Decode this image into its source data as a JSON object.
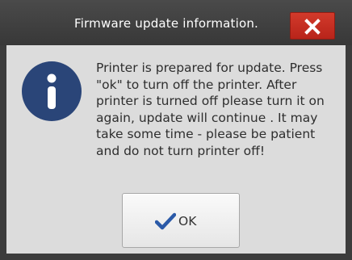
{
  "dialog": {
    "title": "Firmware update information.",
    "close_icon": "close-icon",
    "close_color": "#c9302c",
    "info_icon": "info-icon",
    "info_color": "#2a4578",
    "message": "Printer is prepared for update. Press\n\"ok\" to turn off the printer. After\nprinter is turned off please turn it on\nagain, update will continue . It may\ntake some time - please be patient\nand do not turn printer off!",
    "ok_icon": "checkmark-icon",
    "ok_icon_color": "#2b5aa8",
    "ok_label": "OK"
  }
}
